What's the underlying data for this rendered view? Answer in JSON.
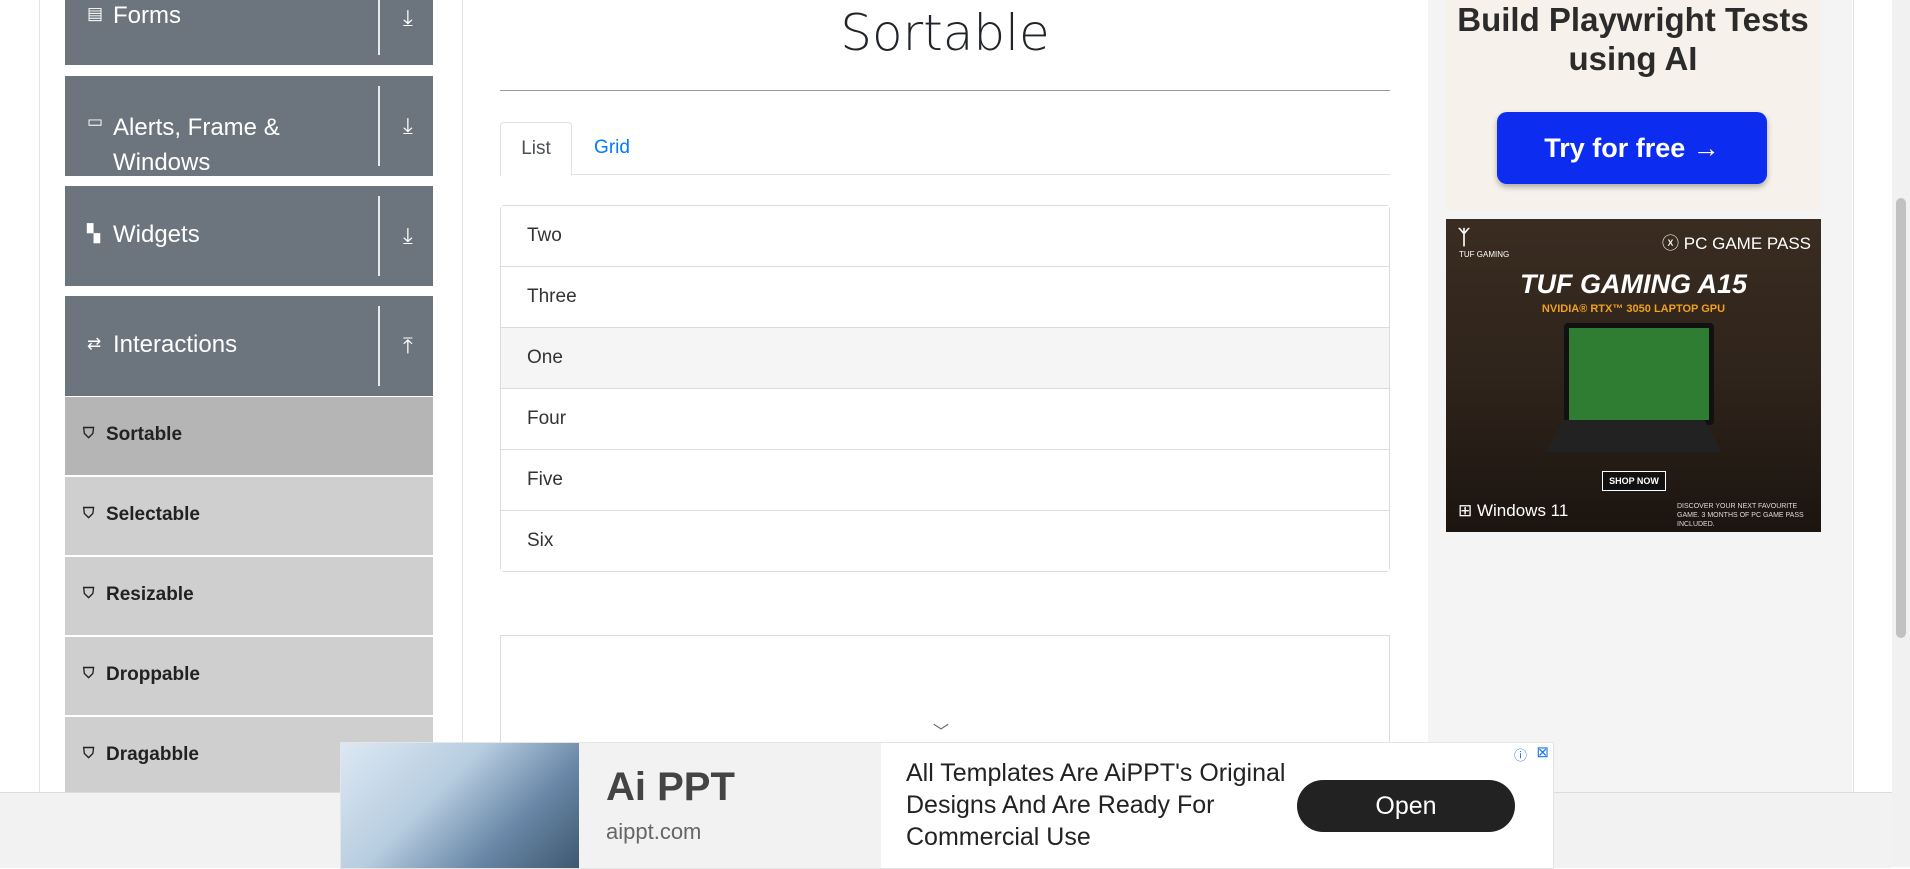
{
  "sidebar": {
    "groups": [
      {
        "label": "Forms",
        "icon": "document-icon",
        "arrow": "download-arrow-icon"
      },
      {
        "label": "Alerts, Frame & Windows",
        "icon": "window-icon",
        "arrow": "download-arrow-icon"
      },
      {
        "label": "Widgets",
        "icon": "widgets-icon",
        "arrow": "download-arrow-icon"
      },
      {
        "label": "Interactions",
        "icon": "interactions-icon",
        "arrow": "upload-arrow-icon"
      }
    ],
    "items": [
      {
        "label": "Sortable",
        "icon": "html5-icon",
        "active": true
      },
      {
        "label": "Selectable",
        "icon": "html5-icon"
      },
      {
        "label": "Resizable",
        "icon": "html5-icon"
      },
      {
        "label": "Droppable",
        "icon": "html5-icon"
      },
      {
        "label": "Dragabble",
        "icon": "html5-icon"
      }
    ]
  },
  "main": {
    "title": "Sortable",
    "tabs": [
      {
        "label": "List",
        "active": true
      },
      {
        "label": "Grid",
        "active": false
      }
    ],
    "list_items": [
      "Two",
      "Three",
      "One",
      "Four",
      "Five",
      "Six"
    ]
  },
  "ads": {
    "playwright": {
      "headline": "Build Playwright Tests using AI",
      "cta": "Try for free →"
    },
    "tuf": {
      "brand": "TUF GAMING",
      "pass": "PC GAME PASS",
      "model": "TUF GAMING A15",
      "gpu": "NVIDIA® RTX™ 3050 LAPTOP GPU",
      "shop": "SHOP NOW",
      "windows": "Windows 11",
      "fine_print": "DISCOVER YOUR NEXT FAVOURITE GAME. 3 MONTHS OF PC GAME PASS INCLUDED."
    },
    "bottom": {
      "name": "Ai PPT",
      "url": "aippt.com",
      "description": "All Templates Are AiPPT's Original Designs And Are Ready For Commercial Use",
      "cta": "Open"
    }
  },
  "colors": {
    "sidebar_group_bg": "#6c757d",
    "sidebar_item_bg": "#cfcfcf",
    "sidebar_item_active_bg": "#b5b5b5",
    "tab_link": "#007bff",
    "cta_blue": "#0c2cf0"
  }
}
